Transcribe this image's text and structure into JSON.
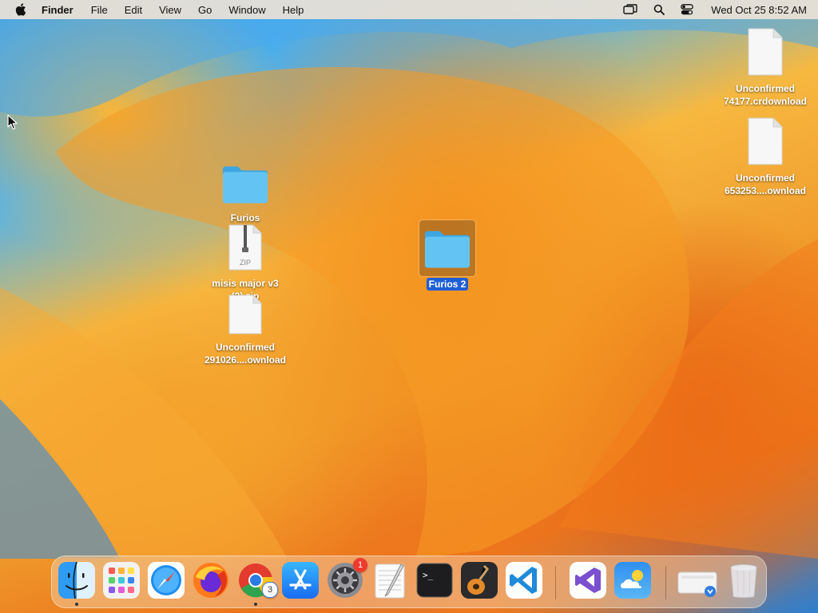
{
  "menubar": {
    "app_name": "Finder",
    "items": [
      "File",
      "Edit",
      "View",
      "Go",
      "Window",
      "Help"
    ],
    "clock": "Wed Oct 25  8:52 AM"
  },
  "desktop": {
    "icons": [
      {
        "label": "Furios",
        "type": "folder"
      },
      {
        "label": "misis major v3 (3).zip",
        "type": "zip",
        "badge_text": "ZIP"
      },
      {
        "label": "Unconfirmed 291026....ownload",
        "type": "document"
      },
      {
        "label": "Furios 2",
        "type": "folder",
        "selected": true
      },
      {
        "label": "Unconfirmed 74177.crdownload",
        "type": "document"
      },
      {
        "label": "Unconfirmed 653253....ownload",
        "type": "document"
      }
    ]
  },
  "dock": {
    "apps": [
      {
        "name": "Finder",
        "icon": "finder-icon",
        "running": true
      },
      {
        "name": "Launchpad",
        "icon": "launchpad-icon"
      },
      {
        "name": "Safari",
        "icon": "safari-icon"
      },
      {
        "name": "Firefox",
        "icon": "firefox-icon"
      },
      {
        "name": "Google Chrome",
        "icon": "chrome-icon",
        "running": true,
        "badge": "3"
      },
      {
        "name": "App Store",
        "icon": "app-store-icon"
      },
      {
        "name": "System Settings",
        "icon": "system-settings-icon",
        "badge": "1"
      },
      {
        "name": "TextEdit",
        "icon": "textedit-icon"
      },
      {
        "name": "Terminal",
        "icon": "terminal-icon"
      },
      {
        "name": "GarageBand",
        "icon": "garageband-icon"
      },
      {
        "name": "Visual Studio Code",
        "icon": "vscode-icon"
      },
      {
        "name": "Visual Studio",
        "icon": "visual-studio-icon"
      },
      {
        "name": "Weather",
        "icon": "weather-icon"
      },
      {
        "name": "Downloads",
        "icon": "downloads-stack-icon"
      },
      {
        "name": "Trash",
        "icon": "trash-icon"
      }
    ],
    "terminal_prompt": ">_"
  },
  "colors": {
    "folder": "#5ec3f2",
    "selection": "#1f5fd6",
    "badge_red": "#f03a2e"
  }
}
